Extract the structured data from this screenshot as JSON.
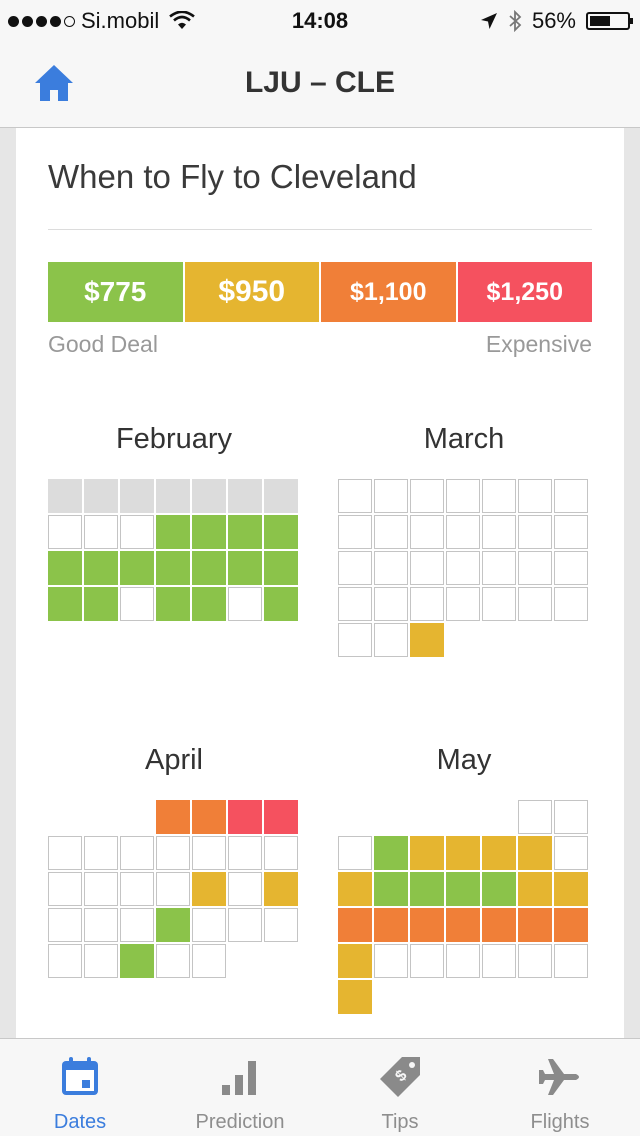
{
  "status_bar": {
    "carrier": "Si.mobil",
    "time": "14:08",
    "battery": "56%",
    "battery_level": 0.56,
    "signal_bars": 4,
    "signal_total": 5
  },
  "nav": {
    "title": "LJU – CLE",
    "home_icon": "home-icon"
  },
  "card": {
    "title": "When to Fly to Cleveland",
    "legend": [
      {
        "label": "$775",
        "color": "#8bc34a"
      },
      {
        "label": "$950",
        "color": "#e5b530"
      },
      {
        "label": "$1,100",
        "color": "#f07f38"
      },
      {
        "label": "$1,250",
        "color": "#f5515f"
      }
    ],
    "legend_low": "Good Deal",
    "legend_high": "Expensive"
  },
  "months": [
    {
      "name": "February",
      "rows": [
        "xxxxxxx",
        "wwwgggg",
        "ggggggg",
        "ggwggwg"
      ]
    },
    {
      "name": "March",
      "rows": [
        "wwwwwww",
        "wwwwwww",
        "wwwwwww",
        "wwwwwww",
        "wwy...."
      ]
    },
    {
      "name": "April",
      "rows": [
        "...oorr",
        "wwwwwww",
        "wwwwywy",
        "wwwgwww",
        "wwgww.."
      ]
    },
    {
      "name": "May",
      "rows": [
        ".....ww",
        "wgyyyyw",
        "yggggyy",
        "ooooooo",
        "ywwwwww",
        "y......"
      ]
    }
  ],
  "tabs": [
    {
      "label": "Dates",
      "icon": "calendar-icon",
      "active": true
    },
    {
      "label": "Prediction",
      "icon": "bar-chart-icon",
      "active": false
    },
    {
      "label": "Tips",
      "icon": "price-tag-icon",
      "active": false
    },
    {
      "label": "Flights",
      "icon": "airplane-icon",
      "active": false
    }
  ]
}
